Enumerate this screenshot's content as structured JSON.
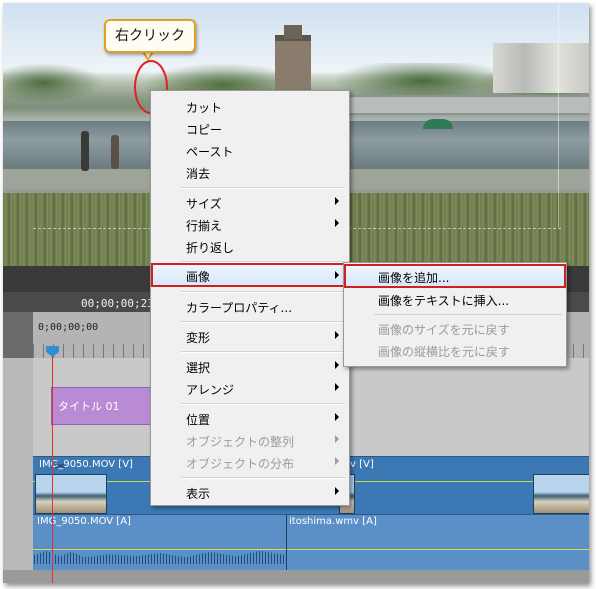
{
  "callout": {
    "text": "右クリック"
  },
  "timeline": {
    "timecode": "00;00;00;23",
    "ruler_time": "0;00;00;00",
    "title_clip": "タイトル 01",
    "video_clip_1": "IMG_9050.MOV [V]",
    "video_clip_2": "v [V]",
    "audio_clip_1": "IMG_9050.MOV [A]",
    "audio_clip_2": "itoshima.wmv [A]"
  },
  "context_menu": {
    "items": [
      {
        "label": "カット",
        "enabled": true,
        "submenu": false
      },
      {
        "label": "コピー",
        "enabled": true,
        "submenu": false
      },
      {
        "label": "ペースト",
        "enabled": true,
        "submenu": false
      },
      {
        "label": "消去",
        "enabled": true,
        "submenu": false
      },
      {
        "label": "サイズ",
        "enabled": true,
        "submenu": true
      },
      {
        "label": "行揃え",
        "enabled": true,
        "submenu": true
      },
      {
        "label": "折り返し",
        "enabled": true,
        "submenu": false
      },
      {
        "label": "画像",
        "enabled": true,
        "submenu": true,
        "highlighted": true
      },
      {
        "label": "カラープロパティ...",
        "enabled": true,
        "submenu": false
      },
      {
        "label": "変形",
        "enabled": true,
        "submenu": true
      },
      {
        "label": "選択",
        "enabled": true,
        "submenu": true
      },
      {
        "label": "アレンジ",
        "enabled": true,
        "submenu": true
      },
      {
        "label": "位置",
        "enabled": true,
        "submenu": true
      },
      {
        "label": "オブジェクトの整列",
        "enabled": false,
        "submenu": true
      },
      {
        "label": "オブジェクトの分布",
        "enabled": false,
        "submenu": true
      },
      {
        "label": "表示",
        "enabled": true,
        "submenu": true
      }
    ]
  },
  "image_submenu": {
    "items": [
      {
        "label": "画像を追加...",
        "enabled": true,
        "highlighted": true
      },
      {
        "label": "画像をテキストに挿入...",
        "enabled": true
      },
      {
        "label": "画像のサイズを元に戻す",
        "enabled": false
      },
      {
        "label": "画像の縦横比を元に戻す",
        "enabled": false
      }
    ]
  },
  "colors": {
    "highlight_border": "#d02020",
    "callout_border": "#e0a020",
    "title_clip": "#b98bd4",
    "video_track": "#3b78b4"
  },
  "icons": {
    "submenu_arrow": "triangle-right",
    "scissors": "scissors-icon"
  }
}
